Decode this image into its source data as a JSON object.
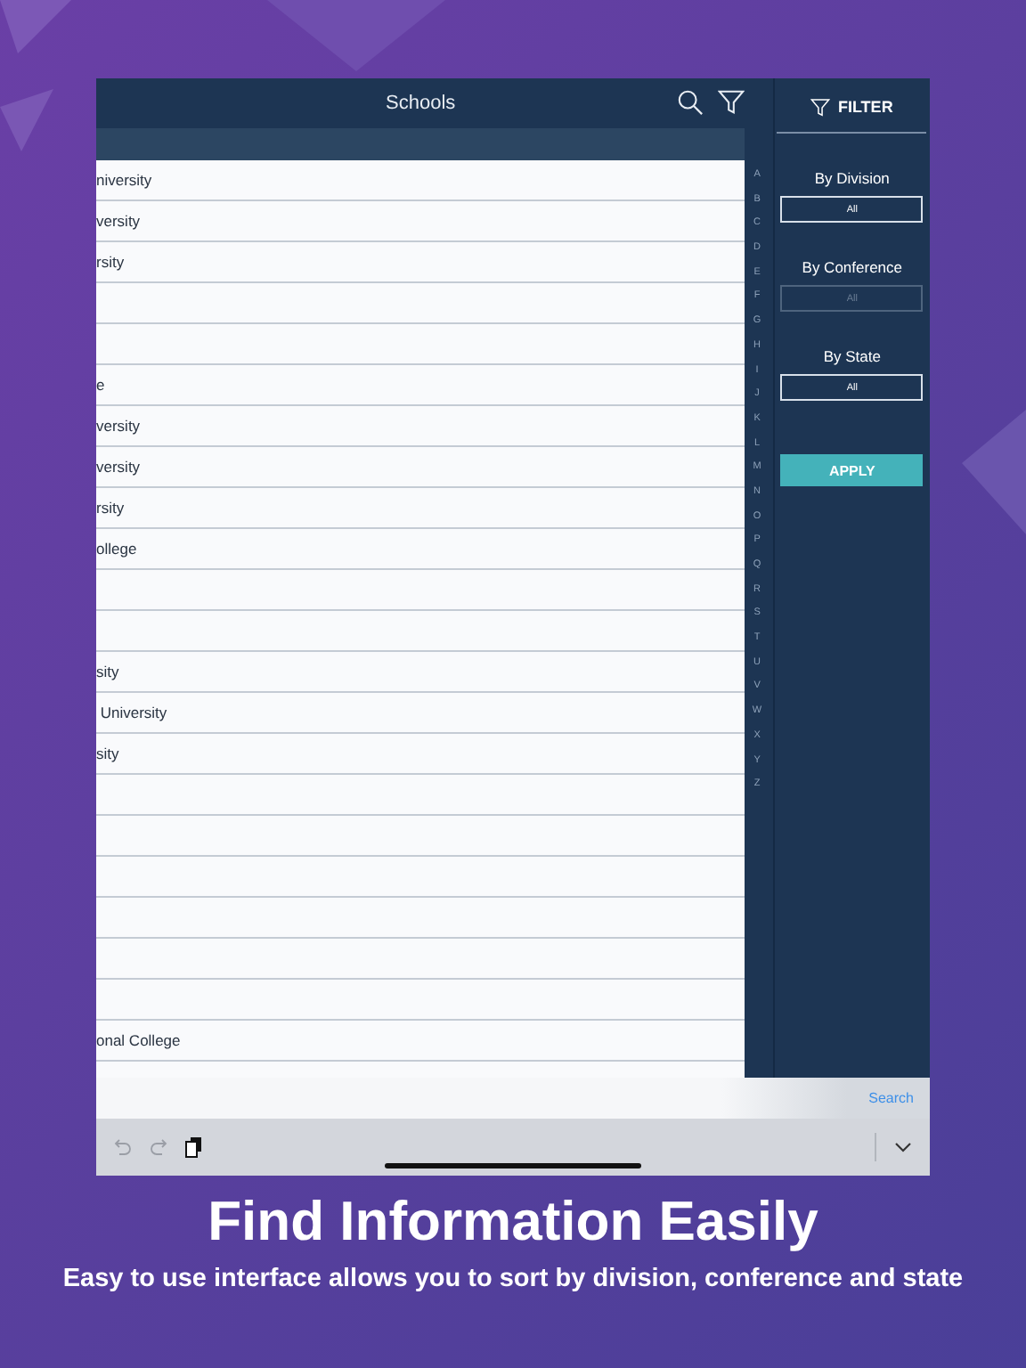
{
  "header": {
    "title": "Schools"
  },
  "rows": [
    "niversity",
    "versity",
    "rsity",
    "",
    "",
    "e",
    "versity",
    "versity",
    "rsity",
    "ollege",
    "",
    "",
    "sity",
    " University",
    "sity",
    "",
    "",
    "",
    "",
    "",
    "",
    "onal College"
  ],
  "index": [
    "A",
    "B",
    "C",
    "D",
    "E",
    "F",
    "G",
    "H",
    "I",
    "J",
    "K",
    "L",
    "M",
    "N",
    "O",
    "P",
    "Q",
    "R",
    "S",
    "T",
    "U",
    "V",
    "W",
    "X",
    "Y",
    "Z"
  ],
  "filter": {
    "title": "FILTER",
    "groups": [
      {
        "label": "By Division",
        "value": "All",
        "disabled": false
      },
      {
        "label": "By Conference",
        "value": "All",
        "disabled": true
      },
      {
        "label": "By State",
        "value": "All",
        "disabled": false
      }
    ],
    "apply": "APPLY"
  },
  "search_bar": {
    "action": "Search"
  },
  "caption": {
    "title": "Find Information Easily",
    "subtitle": "Easy to use interface allows you to sort by division, conference and state"
  }
}
